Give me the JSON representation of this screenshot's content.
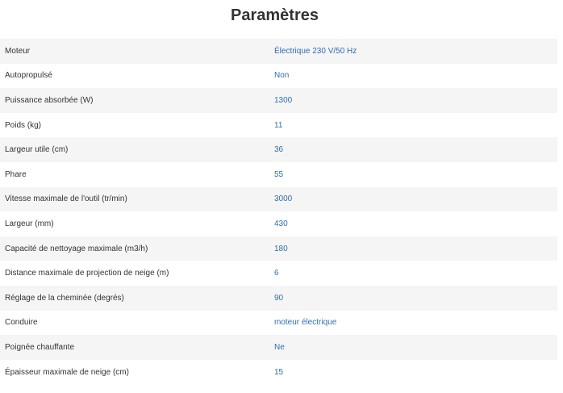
{
  "title": "Paramètres",
  "specs": [
    {
      "label": "Moteur",
      "value": "Électrique 230 V/50 Hz"
    },
    {
      "label": "Autopropulsé",
      "value": "Non"
    },
    {
      "label": "Puissance absorbée (W)",
      "value": "1300"
    },
    {
      "label": "Poids (kg)",
      "value": "11"
    },
    {
      "label": "Largeur utile (cm)",
      "value": "36"
    },
    {
      "label": "Phare",
      "value": "55"
    },
    {
      "label": "Vitesse maximale de l'outil (tr/min)",
      "value": "3000"
    },
    {
      "label": "Largeur (mm)",
      "value": "430"
    },
    {
      "label": "Capacité de nettoyage maximale (m3/h)",
      "value": "180"
    },
    {
      "label": "Distance maximale de projection de neige (m)",
      "value": "6"
    },
    {
      "label": "Réglage de la cheminée (degrés)",
      "value": "90"
    },
    {
      "label": "Conduire",
      "value": "moteur électrique"
    },
    {
      "label": "Poignée chauffante",
      "value": "Ne"
    },
    {
      "label": "Épaisseur maximale de neige (cm)",
      "value": "15"
    }
  ],
  "colors": {
    "title": "#333333",
    "label": "#333333",
    "value": "#2f6db5",
    "row_shade": "#f5f5f5"
  }
}
